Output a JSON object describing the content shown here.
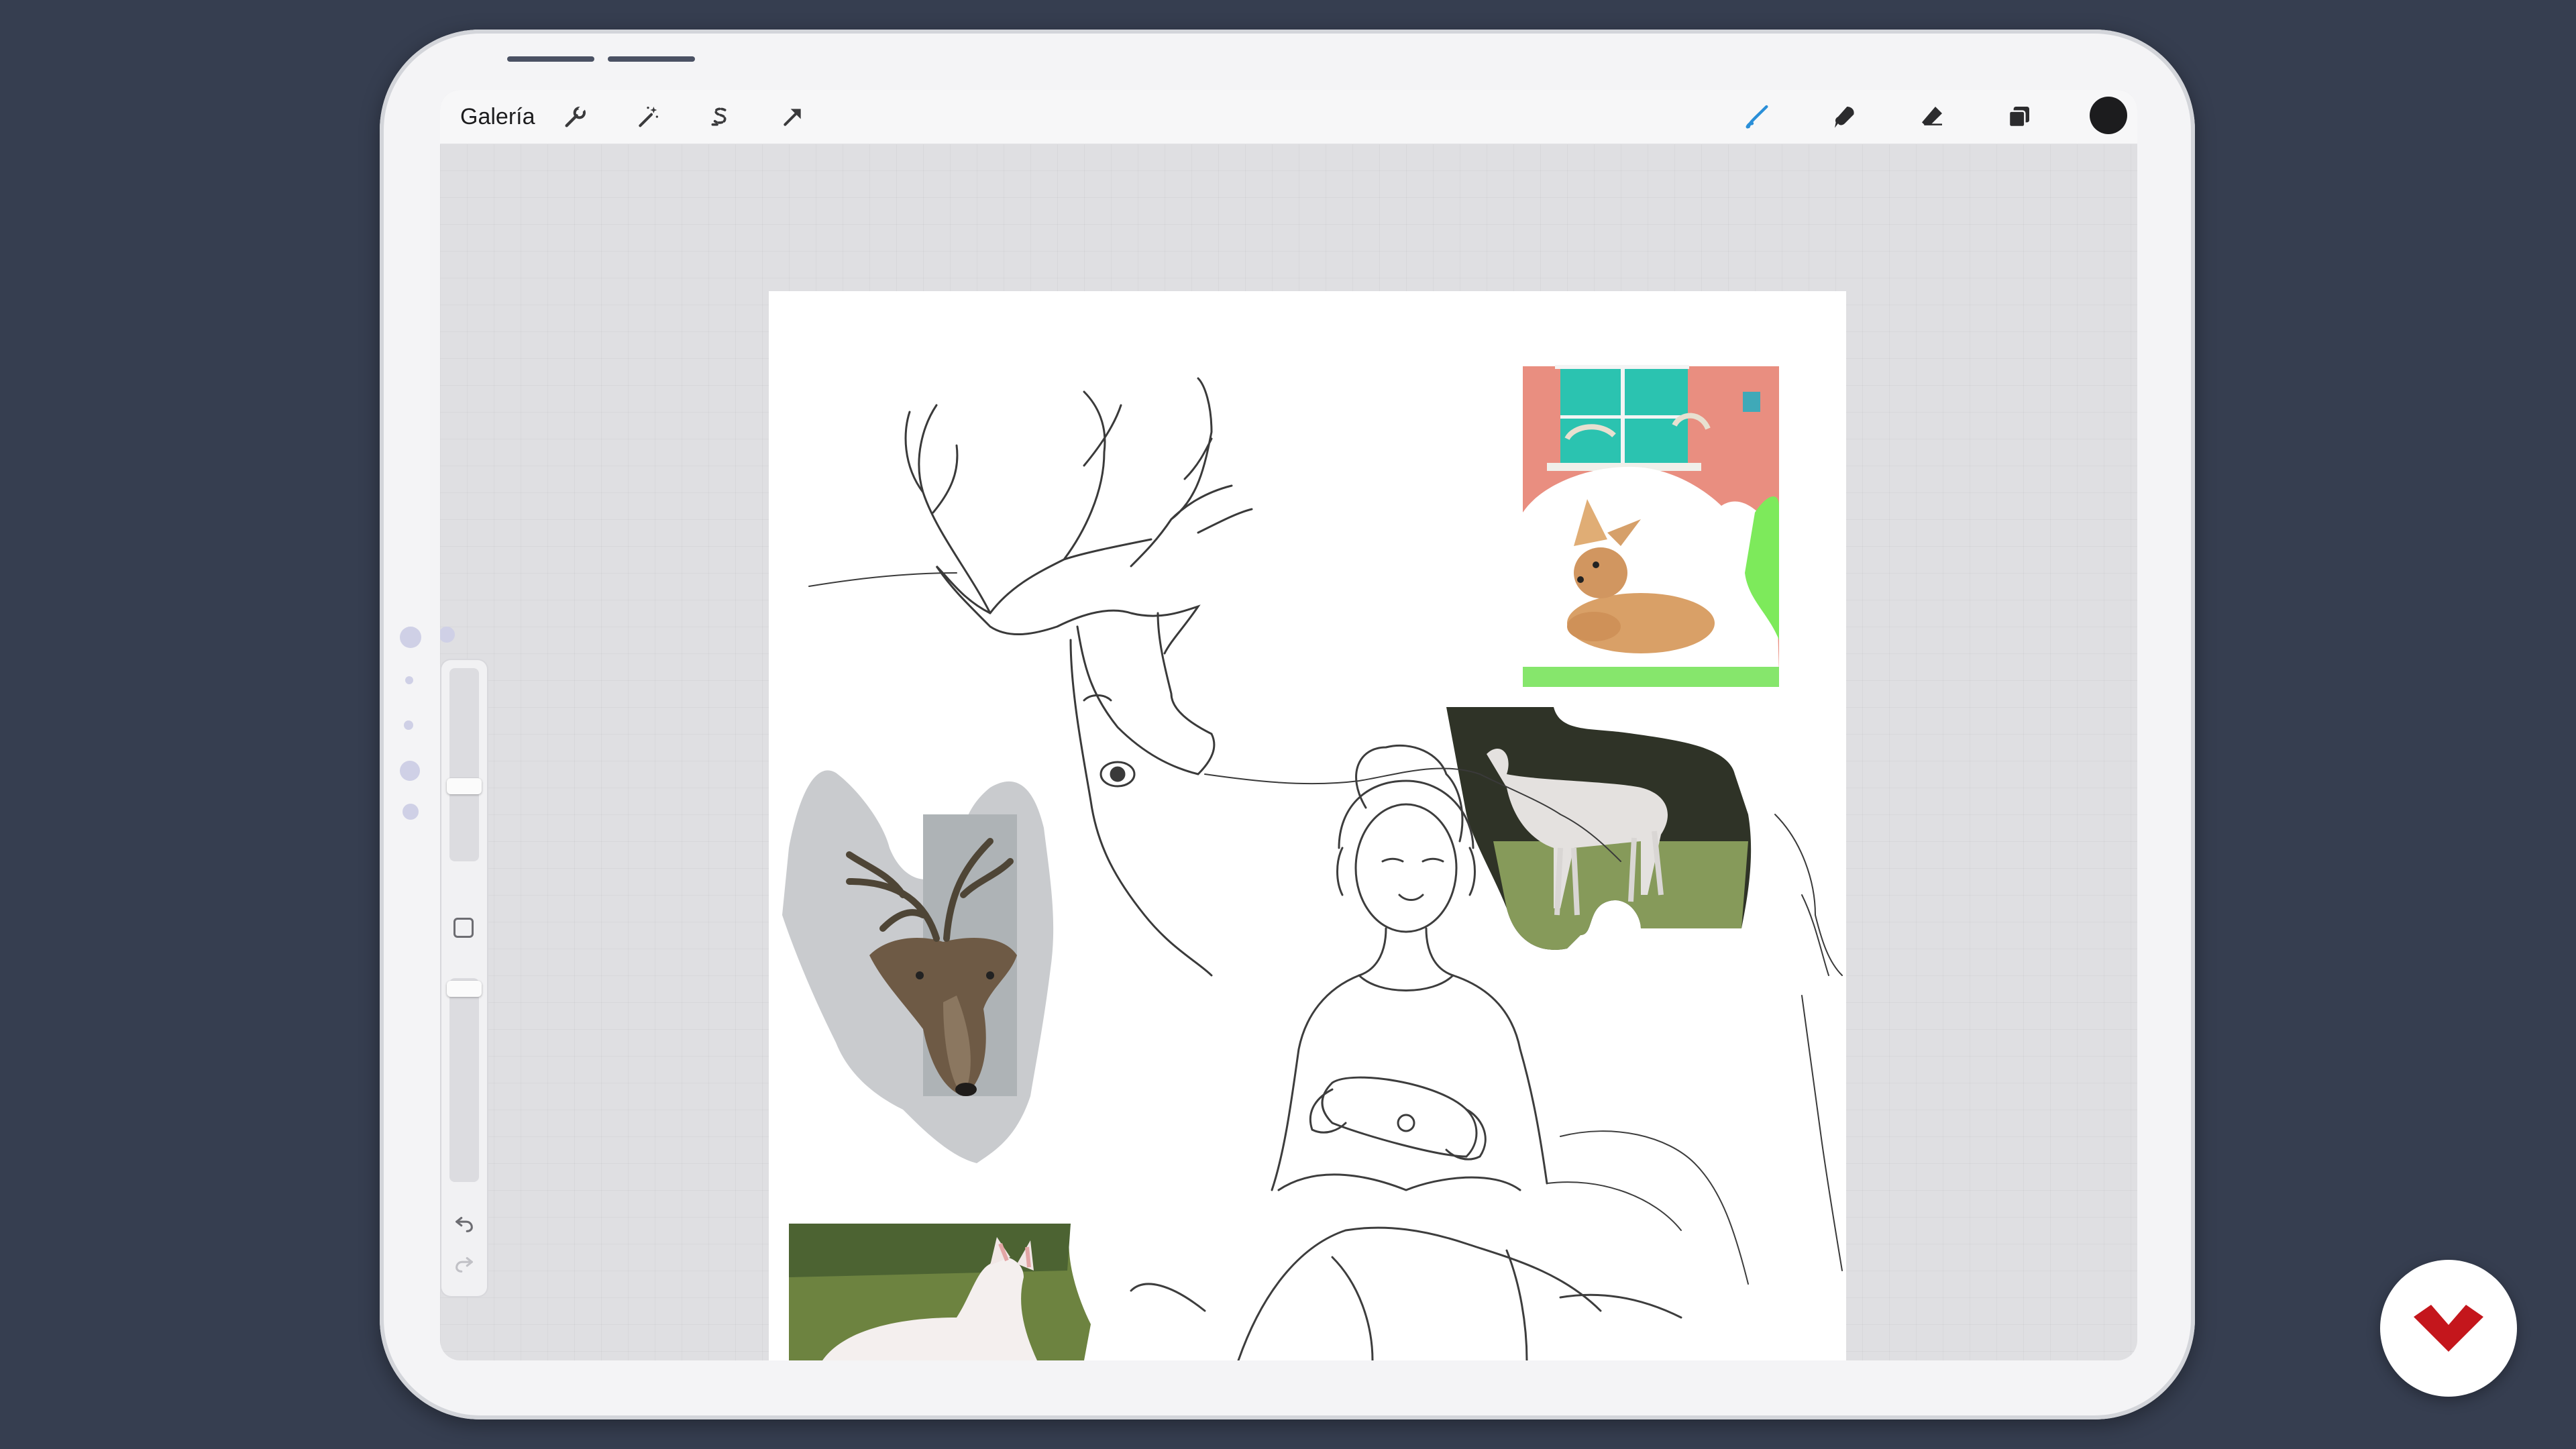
{
  "toolbar": {
    "gallery_label": "Galería",
    "left_tools": [
      "wrench-icon",
      "magic-wand-icon",
      "selection-icon",
      "transform-arrow-icon"
    ],
    "right_tools": [
      "brush-icon",
      "smudge-icon",
      "eraser-icon",
      "layers-icon"
    ],
    "active_tool": "brush-icon",
    "accent_color": "#2a8fd8",
    "current_color": "#1c1c1e"
  },
  "sidebar": {
    "tools": [
      "brush-size-slider",
      "modify-button",
      "opacity-slider",
      "undo-icon",
      "redo-icon"
    ]
  },
  "canvas": {
    "background": "#ffffff",
    "contents": [
      "deer-sketch",
      "girl-with-phone-sketch",
      "reference-photo-fawn",
      "reference-photo-white-deer-standing",
      "reference-photo-mounted-deer-head",
      "reference-photo-white-deer-lying"
    ]
  },
  "brand": {
    "logo_color": "#c4161c"
  }
}
